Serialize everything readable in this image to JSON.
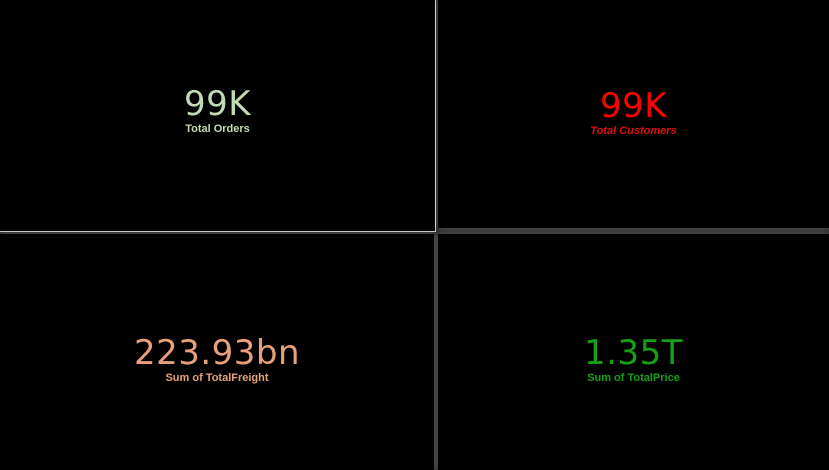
{
  "cards": [
    {
      "value": "99K",
      "label": "Total Orders",
      "color": "#c3dbb4",
      "label_color": "#c3dbb4"
    },
    {
      "value": "99K",
      "label": "Total Customers",
      "color": "#ff0000",
      "label_color": "#e01010"
    },
    {
      "value": "223.93bn",
      "label": "Sum of TotalFreight",
      "color": "#e8a07a",
      "label_color": "#e8a07a"
    },
    {
      "value": "1.35T",
      "label": "Sum of TotalPrice",
      "color": "#16a016",
      "label_color": "#16a016"
    }
  ]
}
